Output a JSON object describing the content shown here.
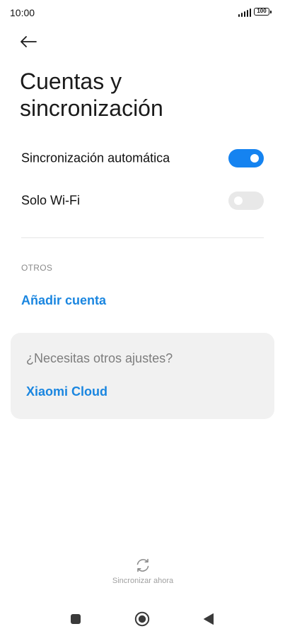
{
  "status_bar": {
    "time": "10:00",
    "battery_level": "100",
    "signal_bars": 4
  },
  "header": {
    "back_icon": "arrow-left-icon",
    "title_line1": "Cuentas y",
    "title_line2": "sincronización"
  },
  "settings": {
    "auto_sync": {
      "label": "Sincronización automática",
      "enabled": true
    },
    "wifi_only": {
      "label": "Solo Wi-Fi",
      "enabled": false
    }
  },
  "others_section": {
    "header": "OTROS",
    "add_account_label": "Añadir cuenta"
  },
  "suggestion_card": {
    "question": "¿Necesitas otros ajustes?",
    "link_label": "Xiaomi Cloud"
  },
  "sync_now": {
    "label": "Sincronizar ahora",
    "icon": "sync-icon"
  },
  "nav_bar": {
    "recents_icon": "square-icon",
    "home_icon": "circle-icon",
    "back_icon": "triangle-back-icon"
  },
  "colors": {
    "accent": "#1583f0",
    "link": "#1a86e0",
    "toggle_off": "#e8e8e8",
    "card_bg": "#f1f1f1"
  }
}
